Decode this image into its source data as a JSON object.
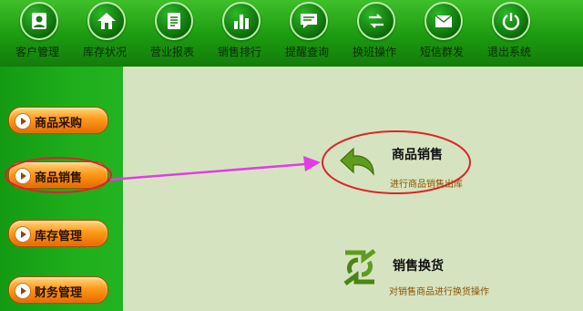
{
  "toolbar": {
    "items": [
      {
        "label": "客户管理",
        "icon": "customer-icon"
      },
      {
        "label": "库存状况",
        "icon": "home-icon"
      },
      {
        "label": "营业报表",
        "icon": "report-icon"
      },
      {
        "label": "销售排行",
        "icon": "bar-chart-icon"
      },
      {
        "label": "提醒查询",
        "icon": "message-icon"
      },
      {
        "label": "换班操作",
        "icon": "swap-arrows-icon"
      },
      {
        "label": "短信群发",
        "icon": "sms-icon"
      },
      {
        "label": "退出系统",
        "icon": "power-icon"
      }
    ]
  },
  "sidebar": {
    "items": [
      {
        "label": "商品采购"
      },
      {
        "label": "商品销售",
        "highlighted": true
      },
      {
        "label": "库存管理"
      },
      {
        "label": "财务管理"
      }
    ]
  },
  "main": {
    "functions": [
      {
        "title": "商品销售",
        "desc": "进行商品销售出库",
        "icon": "return-arrow-icon",
        "highlighted": true
      },
      {
        "title": "销售换货",
        "desc": "对销售商品进行换货操作",
        "icon": "exchange-arrows-icon"
      }
    ]
  },
  "colors": {
    "toolbar_green": "#1c9a10",
    "sidebar_green": "#1fae1c",
    "content_bg": "#d6e3c0",
    "button_orange": "#ff9a1a",
    "annotation_red": "#d9252b",
    "annotation_magenta": "#e23ce6"
  }
}
